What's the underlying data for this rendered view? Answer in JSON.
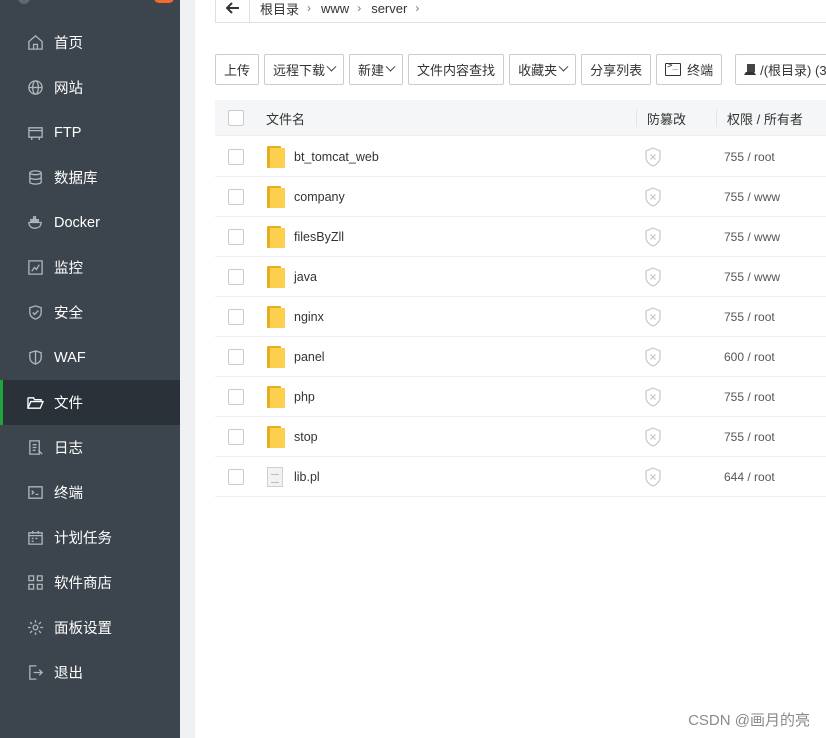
{
  "sidebar": {
    "items": [
      {
        "label": "首页",
        "icon": "home-icon"
      },
      {
        "label": "网站",
        "icon": "globe-icon"
      },
      {
        "label": "FTP",
        "icon": "ftp-icon"
      },
      {
        "label": "数据库",
        "icon": "database-icon"
      },
      {
        "label": "Docker",
        "icon": "docker-icon"
      },
      {
        "label": "监控",
        "icon": "monitor-chart-icon"
      },
      {
        "label": "安全",
        "icon": "shield-check-icon"
      },
      {
        "label": "WAF",
        "icon": "waf-shield-icon"
      },
      {
        "label": "文件",
        "icon": "folder-open-icon",
        "active": true
      },
      {
        "label": "日志",
        "icon": "log-icon"
      },
      {
        "label": "终端",
        "icon": "terminal-icon"
      },
      {
        "label": "计划任务",
        "icon": "calendar-icon"
      },
      {
        "label": "软件商店",
        "icon": "grid-icon"
      },
      {
        "label": "面板设置",
        "icon": "gear-icon"
      },
      {
        "label": "退出",
        "icon": "logout-icon"
      }
    ],
    "accent_color": "#20a53a",
    "badge_color": "#f16c2b"
  },
  "path": {
    "crumbs": [
      "根目录",
      "www",
      "server"
    ]
  },
  "toolbar": {
    "upload": "上传",
    "remote_download": "远程下载",
    "new": "新建",
    "content_search": "文件内容查找",
    "favorites": "收藏夹",
    "share_list": "分享列表",
    "terminal": "终端",
    "disk": "/(根目录) (3…"
  },
  "table": {
    "headers": {
      "name": "文件名",
      "tamper": "防篡改",
      "perm": "权限 / 所有者"
    },
    "rows": [
      {
        "name": "bt_tomcat_web",
        "type": "folder",
        "perm": "755 / root"
      },
      {
        "name": "company",
        "type": "folder",
        "perm": "755 / www"
      },
      {
        "name": "filesByZll",
        "type": "folder",
        "perm": "755 / www"
      },
      {
        "name": "java",
        "type": "folder",
        "perm": "755 / www"
      },
      {
        "name": "nginx",
        "type": "folder",
        "perm": "755 / root"
      },
      {
        "name": "panel",
        "type": "folder",
        "perm": "600 / root"
      },
      {
        "name": "php",
        "type": "folder",
        "perm": "755 / root"
      },
      {
        "name": "stop",
        "type": "folder",
        "perm": "755 / root"
      },
      {
        "name": "lib.pl",
        "type": "file",
        "perm": "644 / root"
      }
    ]
  },
  "watermark": "CSDN @画月的亮"
}
